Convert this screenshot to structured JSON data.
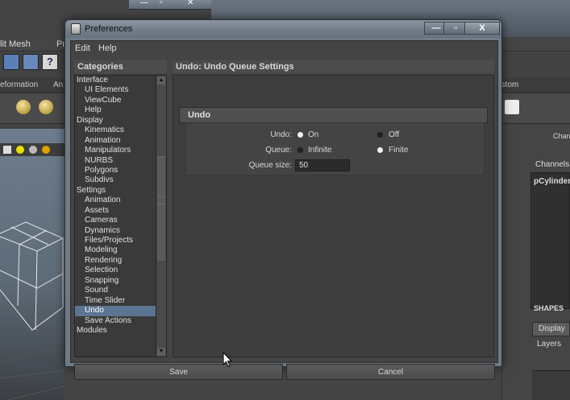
{
  "background": {
    "menubar": [
      "lit Mesh",
      "Pr"
    ],
    "shelf_tabs": [
      "eformation",
      "An",
      "ustom"
    ],
    "right_panel": {
      "tab": "Chann",
      "channels_label": "Channels",
      "object": "pCylinder",
      "shapes": "SHAPES",
      "display_tab": "Display",
      "layers": "Layers"
    }
  },
  "dialog": {
    "title": "Preferences",
    "window_buttons": {
      "minimize": "—",
      "maximize": "▫",
      "close": "X"
    },
    "menu": [
      "Edit",
      "Help"
    ],
    "categories_header": "Categories",
    "categories": [
      {
        "label": "Interface",
        "sub": false
      },
      {
        "label": "UI Elements",
        "sub": true
      },
      {
        "label": "ViewCube",
        "sub": true
      },
      {
        "label": "Help",
        "sub": true
      },
      {
        "label": "Display",
        "sub": false
      },
      {
        "label": "Kinematics",
        "sub": true
      },
      {
        "label": "Animation",
        "sub": true
      },
      {
        "label": "Manipulators",
        "sub": true
      },
      {
        "label": "NURBS",
        "sub": true
      },
      {
        "label": "Polygons",
        "sub": true
      },
      {
        "label": "Subdivs",
        "sub": true
      },
      {
        "label": "Settings",
        "sub": false
      },
      {
        "label": "Animation",
        "sub": true
      },
      {
        "label": "Assets",
        "sub": true
      },
      {
        "label": "Cameras",
        "sub": true
      },
      {
        "label": "Dynamics",
        "sub": true
      },
      {
        "label": "Files/Projects",
        "sub": true
      },
      {
        "label": "Modeling",
        "sub": true
      },
      {
        "label": "Rendering",
        "sub": true
      },
      {
        "label": "Selection",
        "sub": true
      },
      {
        "label": "Snapping",
        "sub": true
      },
      {
        "label": "Sound",
        "sub": true
      },
      {
        "label": "Time Slider",
        "sub": true
      },
      {
        "label": "Undo",
        "sub": true,
        "selected": true
      },
      {
        "label": "Save Actions",
        "sub": true
      },
      {
        "label": "Modules",
        "sub": false
      }
    ],
    "section_title": "Undo: Undo Queue Settings",
    "frame_title": "Undo",
    "undo": {
      "label": "Undo:",
      "on": "On",
      "off": "Off",
      "value": "On"
    },
    "queue": {
      "label": "Queue:",
      "infinite": "Infinite",
      "finite": "Finite",
      "value": "Finite"
    },
    "queue_size": {
      "label": "Queue size:",
      "value": "50"
    },
    "buttons": {
      "save": "Save",
      "cancel": "Cancel"
    }
  }
}
